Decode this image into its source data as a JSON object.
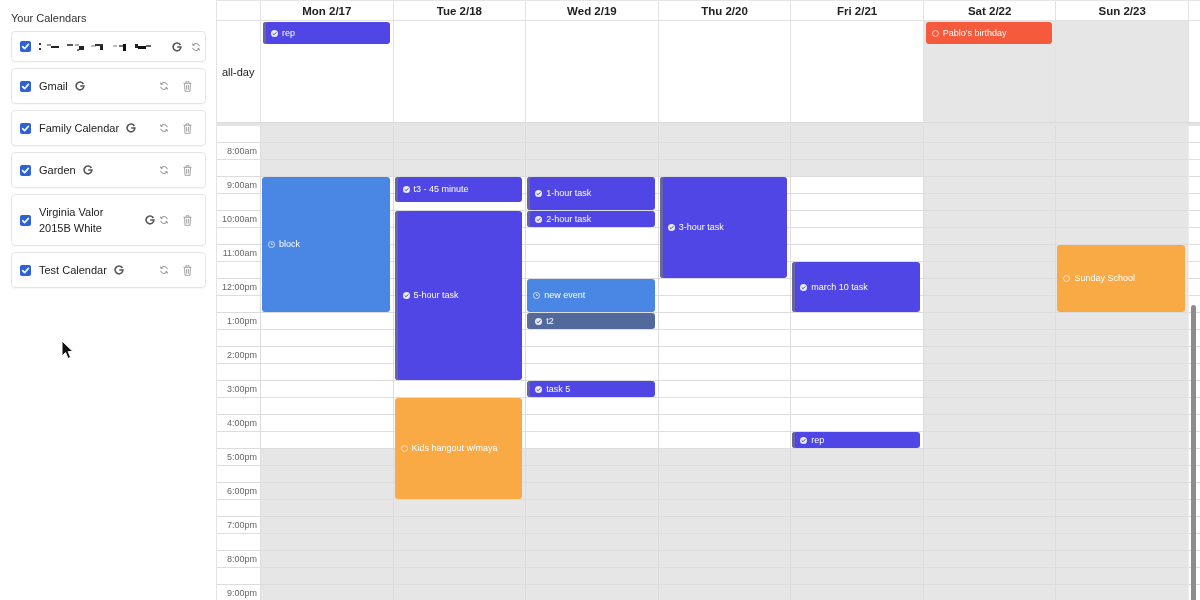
{
  "sidebar": {
    "title": "Your Calendars",
    "calendars": [
      {
        "kind": "redacted",
        "checked": true
      },
      {
        "kind": "named",
        "name": "Gmail",
        "checked": true
      },
      {
        "kind": "named",
        "name": "Family Calendar",
        "checked": true
      },
      {
        "kind": "named",
        "name": "Garden",
        "checked": true
      },
      {
        "kind": "named",
        "name": "Virginia Valor 2015B White",
        "checked": true
      },
      {
        "kind": "named",
        "name": "Test Calendar",
        "checked": true
      }
    ]
  },
  "week": {
    "all_day_label": "all-day",
    "hours": [
      {
        "label": "8:00am",
        "business": false
      },
      {
        "label": "9:00am",
        "business": true
      },
      {
        "label": "10:00am",
        "business": true
      },
      {
        "label": "11:00am",
        "business": true
      },
      {
        "label": "12:00pm",
        "business": true
      },
      {
        "label": "1:00pm",
        "business": true
      },
      {
        "label": "2:00pm",
        "business": true
      },
      {
        "label": "3:00pm",
        "business": true
      },
      {
        "label": "4:00pm",
        "business": true
      },
      {
        "label": "5:00pm",
        "business": false
      },
      {
        "label": "6:00pm",
        "business": false
      },
      {
        "label": "7:00pm",
        "business": false
      },
      {
        "label": "8:00pm",
        "business": false
      },
      {
        "label": "9:00pm",
        "business": false
      }
    ],
    "days": [
      {
        "label": "Mon 2/17",
        "off_day": false,
        "all_day": [
          {
            "title": "rep",
            "kind": "task",
            "color": "#4f46e5"
          }
        ],
        "events": [
          {
            "title": "block",
            "kind": "event",
            "color": "#4a86e3"
          }
        ]
      },
      {
        "label": "Tue 2/18",
        "off_day": false,
        "events": [
          {
            "title": "t3 - 45 minute",
            "kind": "task",
            "color": "#4f46e5"
          },
          {
            "title": "5-hour task",
            "kind": "task",
            "color": "#4f46e5"
          },
          {
            "title": "Kids hangout w/maya",
            "kind": "external",
            "color": "#f9aa45"
          }
        ]
      },
      {
        "label": "Wed 2/19",
        "off_day": false,
        "events": [
          {
            "title": "1-hour task",
            "kind": "task",
            "color": "#4f46e5"
          },
          {
            "title": "2-hour task",
            "kind": "task",
            "color": "#4f46e5"
          },
          {
            "title": "new event",
            "kind": "event",
            "color": "#4a86e3"
          },
          {
            "title": "t2",
            "kind": "task",
            "color": "#52699c"
          },
          {
            "title": "task 5",
            "kind": "task",
            "color": "#4f46e5"
          }
        ]
      },
      {
        "label": "Thu 2/20",
        "off_day": false,
        "events": [
          {
            "title": "3-hour task",
            "kind": "task",
            "color": "#4f46e5"
          }
        ]
      },
      {
        "label": "Fri 2/21",
        "off_day": false,
        "events": [
          {
            "title": "march 10 task",
            "kind": "task",
            "color": "#4f46e5"
          },
          {
            "title": "rep",
            "kind": "task",
            "color": "#4f46e5"
          }
        ]
      },
      {
        "label": "Sat 2/22",
        "off_day": true,
        "all_day": [
          {
            "title": "Pablo's birthday",
            "kind": "external",
            "color": "#f45a3b"
          }
        ]
      },
      {
        "label": "Sun 2/23",
        "off_day": true,
        "events": [
          {
            "title": "Sunday School",
            "kind": "external",
            "color": "#f9aa45"
          }
        ]
      }
    ]
  }
}
